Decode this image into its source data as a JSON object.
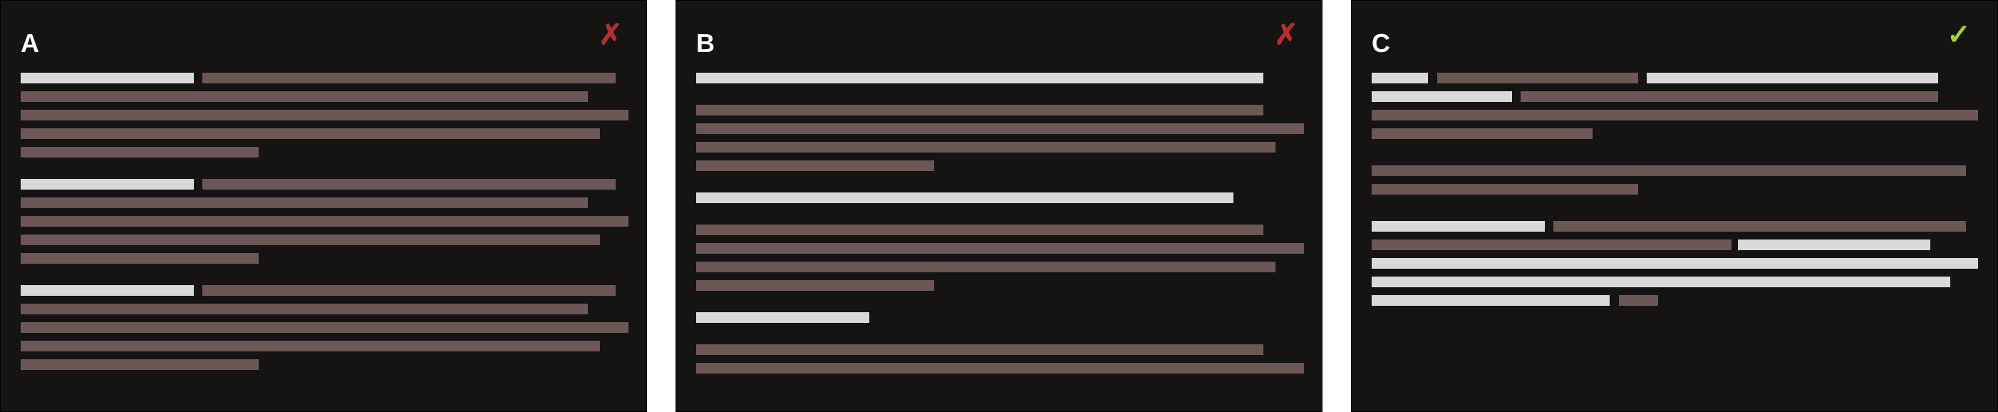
{
  "colors": {
    "background": "#151413",
    "highlight_bar": "#d9d9d9",
    "text_bar": "#6b5754",
    "reject": "#b03030",
    "accept": "#a3cf3a"
  },
  "panels": [
    {
      "label": "A",
      "verdict": "incorrect",
      "icon": "x-icon",
      "icon_glyph": "✗"
    },
    {
      "label": "B",
      "verdict": "incorrect",
      "icon": "x-icon",
      "icon_glyph": "✗"
    },
    {
      "label": "C",
      "verdict": "correct",
      "icon": "check-icon",
      "icon_glyph": "✓"
    }
  ]
}
